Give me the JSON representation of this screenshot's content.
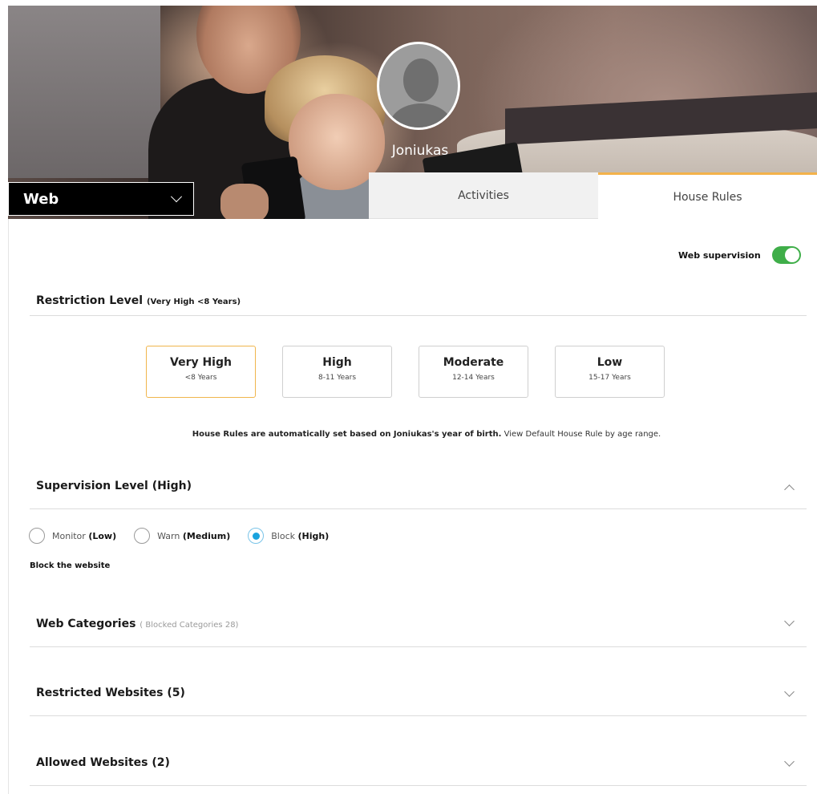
{
  "header": {
    "child_name": "Joniukas",
    "device": "Web",
    "tabs": [
      {
        "label": "Activities",
        "active": false
      },
      {
        "label": "House Rules",
        "active": true
      }
    ],
    "accent_color": "#f3b24a"
  },
  "web_supervision": {
    "label": "Web supervision",
    "enabled": true,
    "toggle_color": "#3fae49"
  },
  "restriction": {
    "title": "Restriction Level",
    "subtitle": "(Very High <8 Years)",
    "levels": [
      {
        "title": "Very High",
        "range": "<8 Years",
        "selected": true
      },
      {
        "title": "High",
        "range": "8-11 Years",
        "selected": false
      },
      {
        "title": "Moderate",
        "range": "12-14 Years",
        "selected": false
      },
      {
        "title": "Low",
        "range": "15-17 Years",
        "selected": false
      }
    ],
    "note_bold": "House Rules are automatically set based on Joniukas's year of birth.",
    "note_link": "View Default House Rule by age range."
  },
  "supervision": {
    "title": "Supervision Level (High)",
    "options": [
      {
        "name": "Monitor",
        "level": "(Low)",
        "selected": false
      },
      {
        "name": "Warn",
        "level": "(Medium)",
        "selected": false
      },
      {
        "name": "Block",
        "level": "(High)",
        "selected": true
      }
    ],
    "description": "Block the website",
    "radio_color": "#1aa3de"
  },
  "sections": [
    {
      "title": "Web Categories",
      "detail": "( Blocked Categories 28)"
    },
    {
      "title": "Restricted Websites (5)"
    },
    {
      "title": "Allowed Websites (2)"
    }
  ]
}
